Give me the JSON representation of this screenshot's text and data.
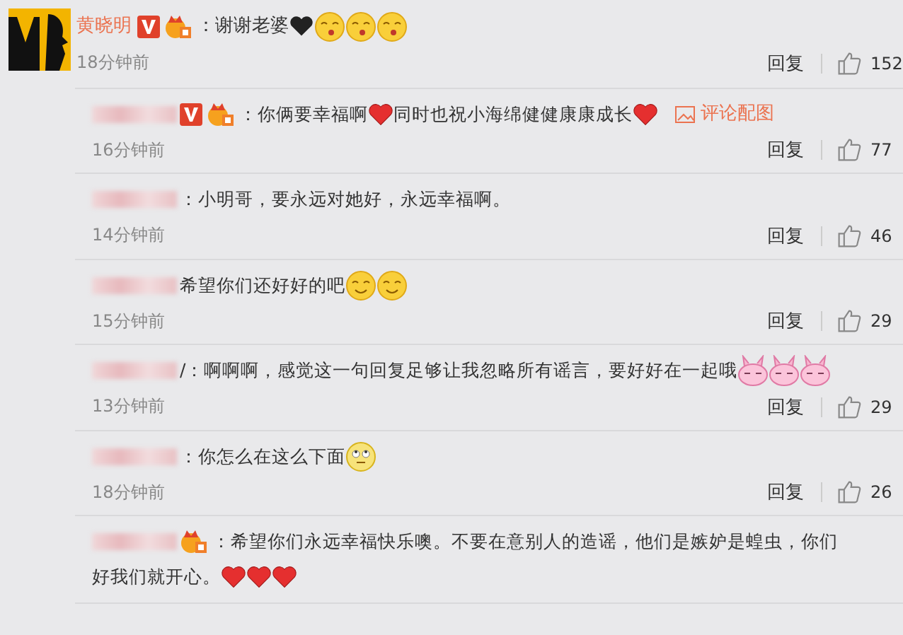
{
  "comment": {
    "author": {
      "name": "黄晓明",
      "verified": true,
      "member": true
    },
    "parts": [
      {
        "kind": "text",
        "text": "：谢谢老婆"
      },
      {
        "kind": "black-heart"
      },
      {
        "kind": "kiss"
      },
      {
        "kind": "kiss"
      },
      {
        "kind": "kiss"
      }
    ],
    "time": "18分钟前",
    "reply": "回复",
    "likes": "152"
  },
  "replies": [
    {
      "author": {
        "verified": true,
        "member": true
      },
      "parts": [
        {
          "kind": "text",
          "text": "：你俩要幸福啊"
        },
        {
          "kind": "heart"
        },
        {
          "kind": "text",
          "text": " 同时也祝小海绵健健康康成长"
        },
        {
          "kind": "heart"
        },
        {
          "kind": "link",
          "text": "评论配图"
        }
      ],
      "time": "16分钟前",
      "reply": "回复",
      "likes": "77"
    },
    {
      "author": {
        "verified": false,
        "member": false
      },
      "parts": [
        {
          "kind": "text",
          "text": "：小明哥，要永远对她好，永远幸福啊。"
        }
      ],
      "time": "14分钟前",
      "reply": "回复",
      "likes": "46"
    },
    {
      "author": {
        "verified": false,
        "member": false
      },
      "parts": [
        {
          "kind": "text",
          "text": " 希望你们还好好的吧"
        },
        {
          "kind": "smile"
        },
        {
          "kind": "smile"
        }
      ],
      "time": "15分钟前",
      "reply": "回复",
      "likes": "29"
    },
    {
      "author": {
        "verified": false,
        "member": false
      },
      "parts": [
        {
          "kind": "text",
          "text": "/：啊啊啊，感觉这一句回复足够让我忽略所有谣言，要好好在一起哦"
        },
        {
          "kind": "bunny"
        },
        {
          "kind": "bunny"
        },
        {
          "kind": "bunny"
        }
      ],
      "time": "13分钟前",
      "reply": "回复",
      "likes": "29"
    },
    {
      "author": {
        "verified": false,
        "member": false
      },
      "parts": [
        {
          "kind": "text",
          "text": "：你怎么在这么下面"
        },
        {
          "kind": "roll-eyes"
        }
      ],
      "time": "18分钟前",
      "reply": "回复",
      "likes": "26"
    },
    {
      "author": {
        "verified": false,
        "member": true
      },
      "parts": [
        {
          "kind": "text",
          "text": "：希望你们永远幸福快乐噢。不要在意别人的造谣，他们是嫉妒是蝗虫，你们"
        },
        {
          "kind": "text",
          "text": "好我们就开心。"
        },
        {
          "kind": "heart"
        },
        {
          "kind": "heart"
        },
        {
          "kind": "heart"
        }
      ]
    }
  ]
}
